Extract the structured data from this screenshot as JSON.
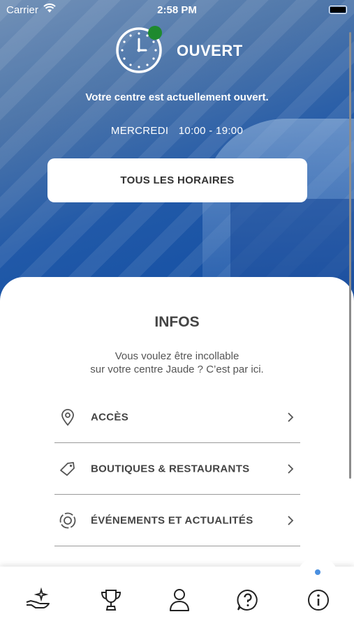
{
  "status_bar": {
    "carrier": "Carrier",
    "time": "2:58 PM"
  },
  "hero": {
    "status_title": "OUVERT",
    "status_subtitle": "Votre centre est actuellement ouvert.",
    "day": "MERCREDI",
    "hours": "10:00 - 19:00",
    "all_hours_button": "TOUS LES HORAIRES",
    "status_color": "#1e8a2e"
  },
  "infos": {
    "title": "INFOS",
    "description_line1": "Vous voulez être incollable",
    "description_line2": "sur votre centre Jaude ? C’est par ici.",
    "items": [
      {
        "label": "ACCÈS",
        "icon": "location-pin-icon"
      },
      {
        "label": "BOUTIQUES & RESTAURANTS",
        "icon": "tag-icon"
      },
      {
        "label": "ÉVÉNEMENTS ET ACTUALITÉS",
        "icon": "event-icon"
      }
    ]
  },
  "tabbar": {
    "tabs": [
      {
        "icon": "hand-sparkle-icon"
      },
      {
        "icon": "trophy-icon"
      },
      {
        "icon": "user-icon"
      },
      {
        "icon": "help-icon"
      },
      {
        "icon": "info-icon",
        "active": true
      }
    ],
    "accent": "#4a8fe0"
  }
}
